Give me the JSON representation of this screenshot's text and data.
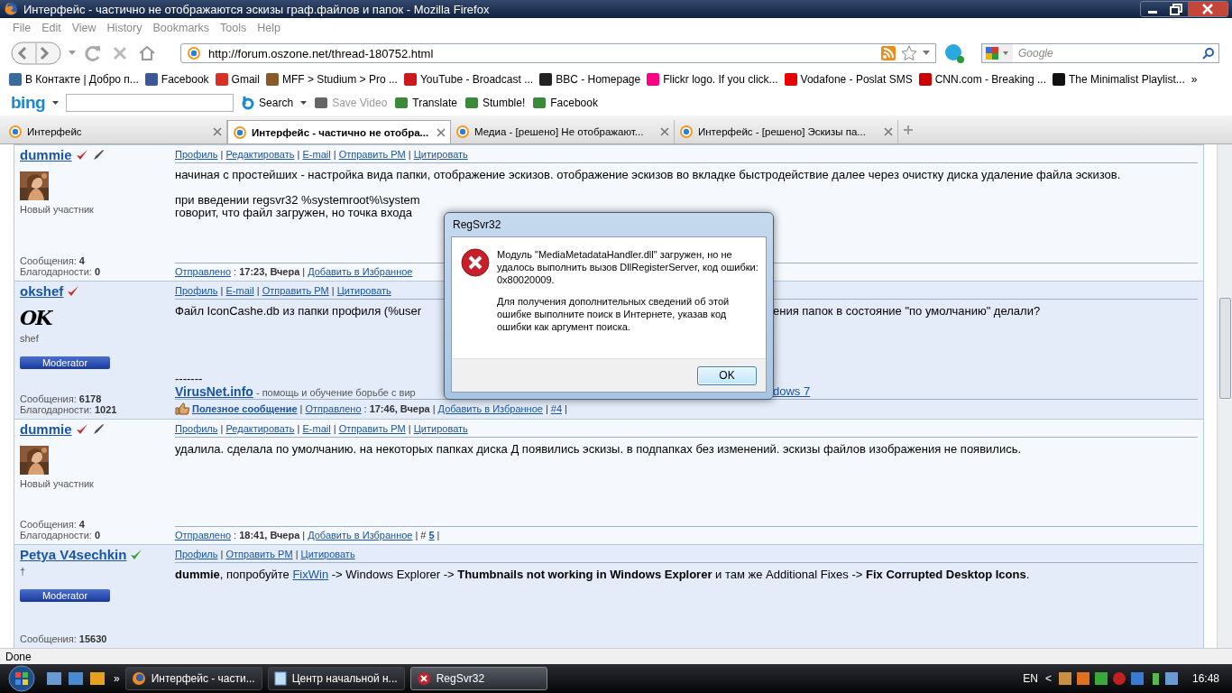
{
  "window": {
    "title": "Интерфейс - частично не отображаются эскизы граф.файлов и папок - Mozilla Firefox"
  },
  "menu": [
    "File",
    "Edit",
    "View",
    "History",
    "Bookmarks",
    "Tools",
    "Help"
  ],
  "address": {
    "value": "http://forum.oszone.net/thread-180752.html"
  },
  "search": {
    "placeholder": "Google"
  },
  "bookmarks": [
    {
      "label": "В Контакте | Добро п...",
      "color": "#3b6a9c"
    },
    {
      "label": "Facebook",
      "color": "#3b5998"
    },
    {
      "label": "Gmail",
      "color": "#d93025"
    },
    {
      "label": "MFF > Studium > Pro ...",
      "color": "#8a5a2b"
    },
    {
      "label": "YouTube - Broadcast ...",
      "color": "#cc181e"
    },
    {
      "label": "BBC - Homepage",
      "color": "#222222"
    },
    {
      "label": "Flickr logo. If you click...",
      "color": "#ff0084"
    },
    {
      "label": "Vodafone - Poslat SMS",
      "color": "#e60000"
    },
    {
      "label": "CNN.com - Breaking ...",
      "color": "#cc0000"
    },
    {
      "label": "The Minimalist Playlist...",
      "color": "#111111"
    }
  ],
  "bookmarks_more": "»",
  "toolbar": {
    "logo": "bing",
    "search_label": "Search",
    "items": [
      {
        "label": "Save Video",
        "disabled": true
      },
      {
        "label": "Translate",
        "disabled": false
      },
      {
        "label": "Stumble!",
        "disabled": false
      },
      {
        "label": "Facebook",
        "disabled": false
      }
    ]
  },
  "tabs": [
    {
      "label": "Интерфейс",
      "selected": false
    },
    {
      "label": "Интерфейс - частично не отобра...",
      "selected": true
    },
    {
      "label": "Медиа - [решено] Не отображают...",
      "selected": false
    },
    {
      "label": "Интерфейс - [решено] Эскизы па...",
      "selected": false
    }
  ],
  "posts": [
    {
      "username": "dummie",
      "color": "#cc2b2b",
      "pen": true,
      "highlighted": false,
      "avatar": {
        "kind": "picture"
      },
      "rank": "Новый участник",
      "stats": [
        {
          "label": "Сообщения:",
          "value": "4"
        },
        {
          "label": "Благодарности:",
          "value": "0"
        }
      ],
      "links": [
        {
          "kind": "link",
          "text": "Профиль"
        },
        {
          "kind": "sep",
          "text": "|"
        },
        {
          "kind": "link",
          "text": "Редактировать"
        },
        {
          "kind": "sep",
          "text": "|"
        },
        {
          "kind": "link",
          "text": "E-mail"
        },
        {
          "kind": "sep",
          "text": "|"
        },
        {
          "kind": "link",
          "text": "Отправить PM"
        },
        {
          "kind": "sep",
          "text": "|"
        },
        {
          "kind": "link",
          "text": "Цитировать"
        }
      ],
      "message": [
        {
          "kind": "para",
          "segments": [
            {
              "kind": "text",
              "text": "начиная с простейших - настройка вида папки, отображение эскизов. отображение эскизов во вкладке быстродействие далее через очистку диска удаление файла эскизов."
            }
          ]
        },
        {
          "kind": "covered",
          "left": [
            {
              "kind": "text",
              "text": "при введении regsvr32 %systemroot%\\system"
            }
          ]
        },
        {
          "kind": "covered",
          "left": [
            {
              "kind": "text",
              "text": "говорит, что файл загружен, но точка входа"
            }
          ]
        }
      ],
      "footer": [
        {
          "kind": "link",
          "text": "Отправлено"
        },
        {
          "kind": "text",
          "text": ":"
        },
        {
          "kind": "bold",
          "text": "17:23, Вчера"
        },
        {
          "kind": "sep",
          "text": "|"
        },
        {
          "kind": "link",
          "text": "Добавить в Избранное"
        }
      ]
    },
    {
      "username": "okshef",
      "color": "#cc2b2b",
      "pen": false,
      "highlighted": true,
      "avatar": {
        "kind": "signature",
        "text": "OK"
      },
      "rank": "shef",
      "badge": "Moderator",
      "stats": [
        {
          "label": "Сообщения:",
          "value": "6178"
        },
        {
          "label": "Благодарности:",
          "value": "1021"
        }
      ],
      "links": [
        {
          "kind": "link",
          "text": "Профиль"
        },
        {
          "kind": "sep",
          "text": "|"
        },
        {
          "kind": "link",
          "text": "E-mail"
        },
        {
          "kind": "sep",
          "text": "|"
        },
        {
          "kind": "link",
          "text": "Отправить PM"
        },
        {
          "kind": "sep",
          "text": "|"
        },
        {
          "kind": "link",
          "text": "Цитировать"
        }
      ],
      "message": [
        {
          "kind": "covered",
          "left": [
            {
              "kind": "text",
              "text": "Файл IconCashe.db из папки профиля (%user"
            }
          ],
          "right": [
            {
              "kind": "text",
              "text": "ения папок в состояние \"по умолчанию\" делали?"
            }
          ]
        },
        {
          "kind": "signature",
          "segments": [
            {
              "kind": "text",
              "text": "-------"
            }
          ]
        },
        {
          "kind": "covered",
          "left": [
            {
              "kind": "sitelink",
              "text": "VirusNet.info"
            },
            {
              "kind": "note",
              "text": " - помощь и обучение борьбе с вир"
            }
          ],
          "right": [
            {
              "kind": "link",
              "text": "dows 7"
            }
          ]
        }
      ],
      "footer": [
        {
          "kind": "helpful",
          "text": "Полезное сообщение"
        },
        {
          "kind": "sep",
          "text": "|"
        },
        {
          "kind": "link",
          "text": "Отправлено"
        },
        {
          "kind": "text",
          "text": ":"
        },
        {
          "kind": "bold",
          "text": "17:46, Вчера"
        },
        {
          "kind": "sep",
          "text": "|"
        },
        {
          "kind": "link",
          "text": "Добавить в Избранное"
        },
        {
          "kind": "sep",
          "text": "|"
        },
        {
          "kind": "link",
          "text": "#4"
        },
        {
          "kind": "sep",
          "text": "|"
        }
      ]
    },
    {
      "username": "dummie",
      "color": "#cc2b2b",
      "pen": true,
      "highlighted": false,
      "avatar": {
        "kind": "picture"
      },
      "rank": "Новый участник",
      "stats": [
        {
          "label": "Сообщения:",
          "value": "4"
        },
        {
          "label": "Благодарности:",
          "value": "0"
        }
      ],
      "links": [
        {
          "kind": "link",
          "text": "Профиль"
        },
        {
          "kind": "sep",
          "text": "|"
        },
        {
          "kind": "link",
          "text": "Редактировать"
        },
        {
          "kind": "sep",
          "text": "|"
        },
        {
          "kind": "link",
          "text": "E-mail"
        },
        {
          "kind": "sep",
          "text": "|"
        },
        {
          "kind": "link",
          "text": "Отправить PM"
        },
        {
          "kind": "sep",
          "text": "|"
        },
        {
          "kind": "link",
          "text": "Цитировать"
        }
      ],
      "message": [
        {
          "kind": "para",
          "segments": [
            {
              "kind": "text",
              "text": "удалила. сделала по умолчанию. на некоторых папках диска Д появились эскизы. в подпапках без изменений. эскизы файлов изображения не появились."
            }
          ]
        }
      ],
      "footer": [
        {
          "kind": "link",
          "text": "Отправлено"
        },
        {
          "kind": "text",
          "text": ":"
        },
        {
          "kind": "bold",
          "text": "18:41, Вчера"
        },
        {
          "kind": "sep",
          "text": "|"
        },
        {
          "kind": "link",
          "text": "Добавить в Избранное"
        },
        {
          "kind": "sep",
          "text": "|"
        },
        {
          "kind": "text",
          "text": "#"
        },
        {
          "kind": "boldlink",
          "text": "5"
        },
        {
          "kind": "sep",
          "text": "|"
        }
      ]
    },
    {
      "username": "Petya V4sechkin",
      "color": "#3a9a2a",
      "pen": false,
      "highlighted": true,
      "rank": "†",
      "badge": "Moderator",
      "stats": [
        {
          "label": "Сообщения:",
          "value": "15630"
        }
      ],
      "links": [
        {
          "kind": "link",
          "text": "Профиль"
        },
        {
          "kind": "sep",
          "text": "|"
        },
        {
          "kind": "link",
          "text": "Отправить PM"
        },
        {
          "kind": "sep",
          "text": "|"
        },
        {
          "kind": "link",
          "text": "Цитировать"
        }
      ],
      "message": [
        {
          "kind": "para",
          "segments": [
            {
              "kind": "bold",
              "text": "dummie"
            },
            {
              "kind": "text",
              "text": ", попробуйте "
            },
            {
              "kind": "link",
              "text": "FixWin"
            },
            {
              "kind": "text",
              "text": " -> Windows Explorer -> "
            },
            {
              "kind": "bold",
              "text": "Thumbnails not working in Windows Explorer"
            },
            {
              "kind": "text",
              "text": " и там же Additional Fixes -> "
            },
            {
              "kind": "bold",
              "text": "Fix Corrupted Desktop Icons"
            },
            {
              "kind": "text",
              "text": "."
            }
          ]
        }
      ]
    }
  ],
  "dialog": {
    "title": "RegSvr32",
    "paragraphs": [
      "Модуль \"MediaMetadataHandler.dll\" загружен, но не удалось выполнить вызов DllRegisterServer, код ошибки: 0x80020009.",
      "Для получения дополнительных сведений об этой ошибке выполните поиск в Интернете, указав код ошибки как аргумент поиска."
    ],
    "button": "OK"
  },
  "status_bar": "Done",
  "taskbar": {
    "more": "»",
    "tasks": [
      {
        "label": "Интерфейс - части...",
        "kind": "browser",
        "selected": false
      },
      {
        "label": "Центр начальной н...",
        "kind": "document",
        "selected": false
      },
      {
        "label": "RegSvr32",
        "kind": "error",
        "selected": true
      }
    ],
    "language": "EN",
    "tray_expand": "<",
    "time": "16:48"
  }
}
